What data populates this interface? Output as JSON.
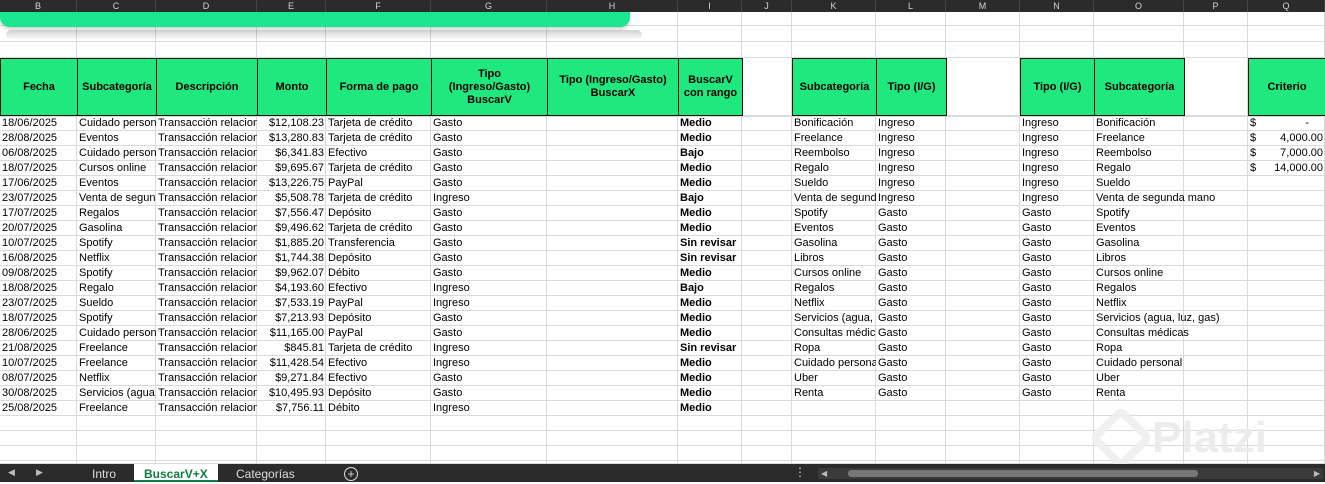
{
  "columns": [
    "B",
    "C",
    "D",
    "E",
    "F",
    "G",
    "H",
    "I",
    "J",
    "K",
    "L",
    "M",
    "N",
    "O",
    "P",
    "Q"
  ],
  "headers": {
    "main": [
      "Fecha",
      "Subcategoría",
      "Descripción",
      "Monto",
      "Forma de pago",
      "Tipo\n(Ingreso/Gasto)\nBuscarV",
      "Tipo (Ingreso/Gasto)\nBuscarX",
      "BuscarV\ncon rango"
    ],
    "lookup1": [
      "Subcategoría",
      "Tipo (I/G)"
    ],
    "lookup2": [
      "Tipo (I/G)",
      "Subcategoría"
    ],
    "criterio": "Criterio"
  },
  "rows": [
    [
      "18/06/2025",
      "Cuidado personal",
      "Transacción relacionada",
      "$12,108.23",
      "Tarjeta de crédito",
      "Gasto",
      "",
      "Medio"
    ],
    [
      "28/08/2025",
      "Eventos",
      "Transacción relacionada",
      "$13,280.83",
      "Tarjeta de crédito",
      "Gasto",
      "",
      "Medio"
    ],
    [
      "06/08/2025",
      "Cuidado personal",
      "Transacción relacionada",
      "$6,341.83",
      "Efectivo",
      "Gasto",
      "",
      "Bajo"
    ],
    [
      "18/07/2025",
      "Cursos online",
      "Transacción relacionada",
      "$9,695.67",
      "Tarjeta de crédito",
      "Gasto",
      "",
      "Medio"
    ],
    [
      "17/06/2025",
      "Eventos",
      "Transacción relacionada",
      "$13,226.75",
      "PayPal",
      "Gasto",
      "",
      "Medio"
    ],
    [
      "23/07/2025",
      "Venta de segunda mano",
      "Transacción relacionada",
      "$5,508.78",
      "Tarjeta de crédito",
      "Ingreso",
      "",
      "Bajo"
    ],
    [
      "17/07/2025",
      "Regalos",
      "Transacción relacionada",
      "$7,556.47",
      "Depósito",
      "Gasto",
      "",
      "Medio"
    ],
    [
      "20/07/2025",
      "Gasolina",
      "Transacción relacionada",
      "$9,496.62",
      "Tarjeta de crédito",
      "Gasto",
      "",
      "Medio"
    ],
    [
      "10/07/2025",
      "Spotify",
      "Transacción relacionada",
      "$1,885.20",
      "Transferencia",
      "Gasto",
      "",
      "Sin revisar"
    ],
    [
      "16/08/2025",
      "Netflix",
      "Transacción relacionada",
      "$1,744.38",
      "Depósito",
      "Gasto",
      "",
      "Sin revisar"
    ],
    [
      "09/08/2025",
      "Spotify",
      "Transacción relacionada",
      "$9,962.07",
      "Débito",
      "Gasto",
      "",
      "Medio"
    ],
    [
      "18/08/2025",
      "Regalo",
      "Transacción relacionada",
      "$4,193.60",
      "Efectivo",
      "Ingreso",
      "",
      "Bajo"
    ],
    [
      "23/07/2025",
      "Sueldo",
      "Transacción relacionada",
      "$7,533.19",
      "PayPal",
      "Ingreso",
      "",
      "Medio"
    ],
    [
      "18/07/2025",
      "Spotify",
      "Transacción relacionada",
      "$7,213.93",
      "Depósito",
      "Gasto",
      "",
      "Medio"
    ],
    [
      "28/06/2025",
      "Cuidado personal",
      "Transacción relacionada",
      "$11,165.00",
      "PayPal",
      "Gasto",
      "",
      "Medio"
    ],
    [
      "21/08/2025",
      "Freelance",
      "Transacción relacionada",
      "$845.81",
      "Tarjeta de crédito",
      "Ingreso",
      "",
      "Sin revisar"
    ],
    [
      "10/07/2025",
      "Freelance",
      "Transacción relacionada",
      "$11,428.54",
      "Efectivo",
      "Ingreso",
      "",
      "Medio"
    ],
    [
      "08/07/2025",
      "Netflix",
      "Transacción relacionada",
      "$9,271.84",
      "Efectivo",
      "Gasto",
      "",
      "Medio"
    ],
    [
      "30/08/2025",
      "Servicios (agua, luz, gas)",
      "Transacción relacionada",
      "$10,495.93",
      "Depósito",
      "Gasto",
      "",
      "Medio"
    ],
    [
      "25/08/2025",
      "Freelance",
      "Transacción relacionada",
      "$7,756.11",
      "Débito",
      "Ingreso",
      "",
      "Medio"
    ]
  ],
  "lookup1_rows": [
    [
      "Bonificación",
      "Ingreso"
    ],
    [
      "Freelance",
      "Ingreso"
    ],
    [
      "Reembolso",
      "Ingreso"
    ],
    [
      "Regalo",
      "Ingreso"
    ],
    [
      "Sueldo",
      "Ingreso"
    ],
    [
      "Venta de segunda mano",
      "Ingreso"
    ],
    [
      "Spotify",
      "Gasto"
    ],
    [
      "Eventos",
      "Gasto"
    ],
    [
      "Gasolina",
      "Gasto"
    ],
    [
      "Libros",
      "Gasto"
    ],
    [
      "Cursos online",
      "Gasto"
    ],
    [
      "Regalos",
      "Gasto"
    ],
    [
      "Netflix",
      "Gasto"
    ],
    [
      "Servicios (agua, luz, gas)",
      "Gasto"
    ],
    [
      "Consultas médicas",
      "Gasto"
    ],
    [
      "Ropa",
      "Gasto"
    ],
    [
      "Cuidado personal",
      "Gasto"
    ],
    [
      "Uber",
      "Gasto"
    ],
    [
      "Renta",
      "Gasto"
    ]
  ],
  "lookup2_rows": [
    [
      "Ingreso",
      "Bonificación"
    ],
    [
      "Ingreso",
      "Freelance"
    ],
    [
      "Ingreso",
      "Reembolso"
    ],
    [
      "Ingreso",
      "Regalo"
    ],
    [
      "Ingreso",
      "Sueldo"
    ],
    [
      "Ingreso",
      "Venta de segunda mano"
    ],
    [
      "Gasto",
      "Spotify"
    ],
    [
      "Gasto",
      "Eventos"
    ],
    [
      "Gasto",
      "Gasolina"
    ],
    [
      "Gasto",
      "Libros"
    ],
    [
      "Gasto",
      "Cursos online"
    ],
    [
      "Gasto",
      "Regalos"
    ],
    [
      "Gasto",
      "Netflix"
    ],
    [
      "Gasto",
      "Servicios (agua, luz, gas)"
    ],
    [
      "Gasto",
      "Consultas médicas"
    ],
    [
      "Gasto",
      "Ropa"
    ],
    [
      "Gasto",
      "Cuidado personal"
    ],
    [
      "Gasto",
      "Uber"
    ],
    [
      "Gasto",
      "Renta"
    ]
  ],
  "criterio_rows": [
    [
      "$",
      "-"
    ],
    [
      "$",
      "4,000.00"
    ],
    [
      "$",
      "7,000.00"
    ],
    [
      "$",
      "14,000.00"
    ]
  ],
  "tabs": [
    "Intro",
    "BuscarV+X",
    "Categorías"
  ],
  "active_tab": "BuscarV+X",
  "watermark": "Platzi",
  "colors": {
    "header_green": "#1fe87e",
    "banner_green": "#19e68e",
    "active_tab": "#107c41"
  }
}
